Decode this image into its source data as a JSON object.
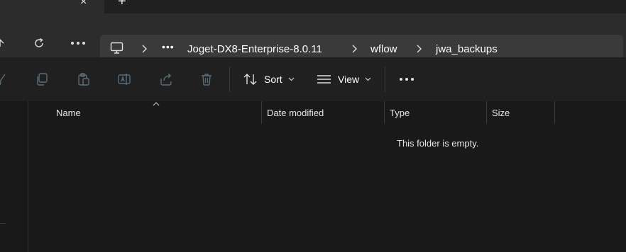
{
  "tabbar": {
    "close_glyph": "×",
    "new_tab_glyph": "+"
  },
  "nav": {
    "up_icon": "up-arrow-icon",
    "refresh_icon": "refresh-icon",
    "more_icon": "more-icon"
  },
  "address": {
    "breadcrumbs": [
      "Joget-DX8-Enterprise-8.0.11",
      "wflow",
      "jwa_backups"
    ],
    "overflow": "•••"
  },
  "toolbar": {
    "sort_label": "Sort",
    "view_label": "View",
    "more_label": "•••"
  },
  "columns": {
    "name": "Name",
    "date_modified": "Date modified",
    "type": "Type",
    "size": "Size"
  },
  "empty_message": "This folder is empty.",
  "colors": {
    "background": "#191919",
    "toolbar": "#202020",
    "address_bg": "#3a3a3a",
    "icon_dim": "#5a6e7a"
  }
}
